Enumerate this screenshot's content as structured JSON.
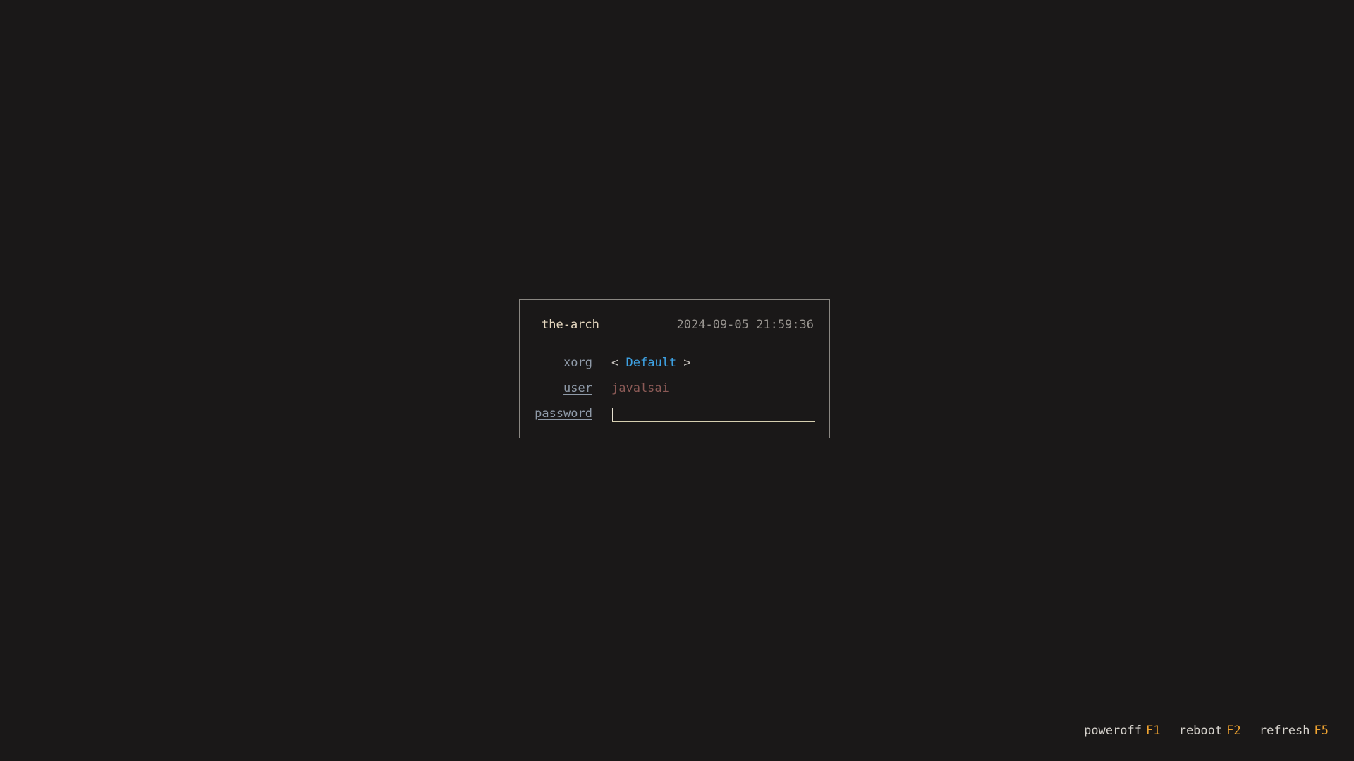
{
  "login": {
    "hostname": "the-arch",
    "datetime": "2024-09-05 21:59:36",
    "session": {
      "label": "xorg",
      "left_arrow": "<",
      "value": "Default",
      "right_arrow": ">"
    },
    "user": {
      "label": "user",
      "value": "javalsai"
    },
    "password": {
      "label": "password",
      "value": ""
    }
  },
  "footer": {
    "actions": [
      {
        "label": "poweroff",
        "key": "F1"
      },
      {
        "label": "reboot",
        "key": "F2"
      },
      {
        "label": "refresh",
        "key": "F5"
      }
    ]
  },
  "colors": {
    "background": "#1a1818",
    "border": "#8a8782",
    "hostname": "#e6d8c0",
    "label": "#8f9aa8",
    "session_accent": "#3ea2e4",
    "user_value": "#8c5a56",
    "key_accent": "#f2a531"
  }
}
